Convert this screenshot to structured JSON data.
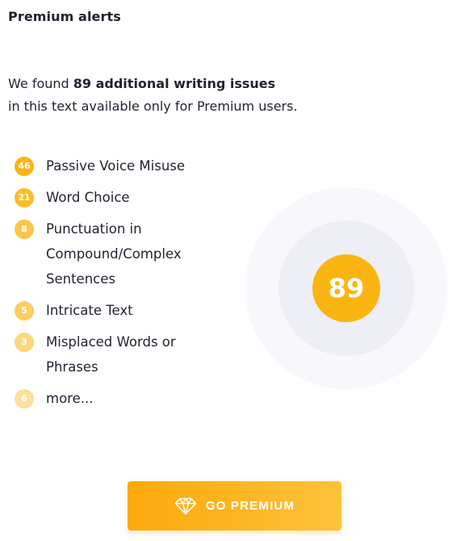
{
  "header": {
    "title": "Premium alerts"
  },
  "intro": {
    "prefix": "We found ",
    "highlight": "89 additional writing issues",
    "line2": "in this text available only for Premium users."
  },
  "issues": [
    {
      "count": "46",
      "label": "Passive Voice Misuse",
      "color": "#fbb512"
    },
    {
      "count": "21",
      "label": "Word Choice",
      "color": "#fbbd2c"
    },
    {
      "count": "8",
      "label": "Punctuation in Compound/Complex Sentences",
      "color": "#fcc647"
    },
    {
      "count": "5",
      "label": "Intricate Text",
      "color": "#fcce62"
    },
    {
      "count": "3",
      "label": "Misplaced Words or Phrases",
      "color": "#fdd77d"
    },
    {
      "count": "6",
      "label": "more...",
      "color": "#fedf9c"
    }
  ],
  "summary": {
    "total": "89",
    "color": "#fbb512"
  },
  "cta": {
    "label": "GO PREMIUM",
    "icon": "diamond-icon"
  }
}
